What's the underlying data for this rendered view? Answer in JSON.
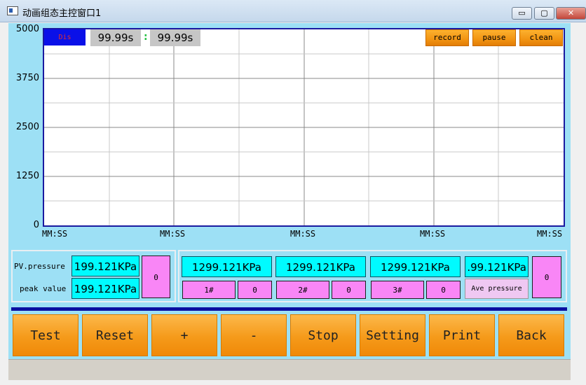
{
  "window": {
    "title": "动画组态主控窗口1",
    "minimize": "▭",
    "maximize": "▢",
    "close": "✕"
  },
  "chart": {
    "display_label": "Dis",
    "time_start": "99.99s",
    "time_sep": ":",
    "time_end": "99.99s",
    "record_label": "record",
    "pause_label": "pause",
    "clean_label": "clean"
  },
  "chart_data": {
    "type": "line",
    "y_ticks": [
      "5000",
      "3750",
      "2500",
      "1250",
      "0"
    ],
    "x_ticks": [
      "MM:SS",
      "MM:SS",
      "MM:SS",
      "MM:SS",
      "MM:SS"
    ],
    "ylim": [
      0,
      5000
    ],
    "grid": true,
    "series": []
  },
  "pressure_panel": {
    "pv_label": "PV.pressure",
    "pv_value": "199.121KPa",
    "peak_label": "peak value",
    "peak_value": "199.121KPa",
    "count": "0"
  },
  "channels": [
    {
      "value": "1299.121KPa",
      "name": "1#",
      "count": "0"
    },
    {
      "value": "1299.121KPa",
      "name": "2#",
      "count": "0"
    },
    {
      "value": "1299.121KPa",
      "name": "3#",
      "count": "0"
    }
  ],
  "average": {
    "value": ".99.121KPa",
    "label": "Ave pressure",
    "count": "0"
  },
  "buttons": {
    "test": "Test",
    "reset": "Reset",
    "plus": "+",
    "minus": "-",
    "stop": "Stop",
    "setting": "Setting",
    "print": "Print",
    "back": "Back"
  }
}
